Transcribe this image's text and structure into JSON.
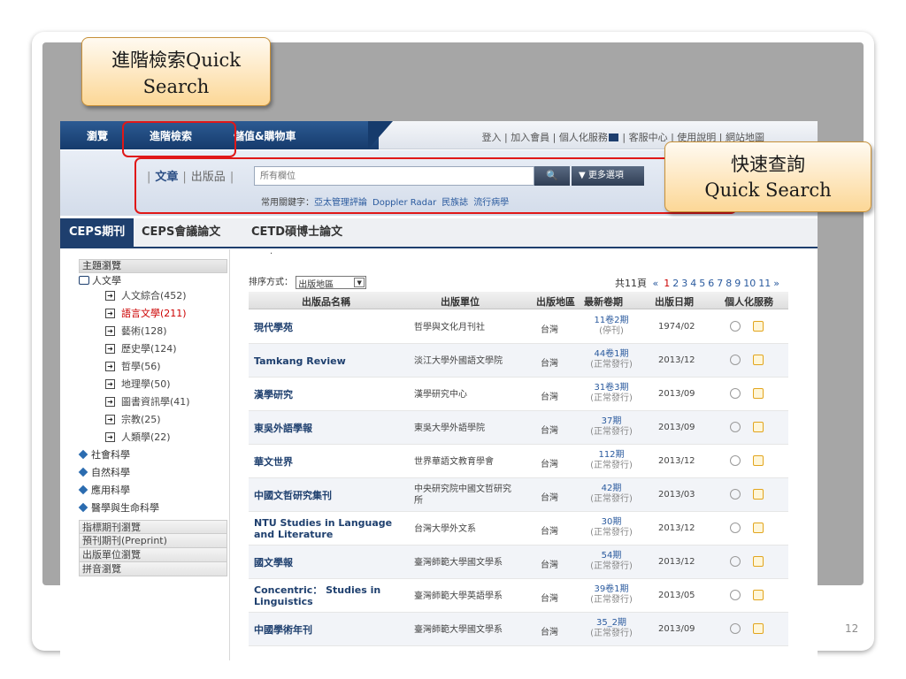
{
  "slide": {
    "page_number": "12"
  },
  "callouts": {
    "advanced_line1": "進階檢索Quick",
    "advanced_line2": "Search",
    "quick_line1": "快速查詢",
    "quick_line2": "Quick Search"
  },
  "topnav": {
    "browse": "瀏覽",
    "advanced": "進階檢索",
    "store": "儲值&購物車",
    "links": {
      "login": "登入",
      "join": "加入會員",
      "personal": "個人化服務",
      "service": "客服中心",
      "help": "使用說明",
      "sitemap": "網站地圖"
    }
  },
  "search": {
    "scope_article": "文章",
    "scope_publication": "出版品",
    "placeholder": "所有欄位",
    "search_icon_glyph": "🔍",
    "more_options": "▼ 更多選項",
    "keywords_label": "常用關鍵字：",
    "keywords": [
      "亞太管理評論",
      "Doppler Radar",
      "民族誌",
      "流行病學"
    ]
  },
  "db_tabs": [
    "CEPS期刊",
    "CEPS會議論文",
    "CETD碩博士論文"
  ],
  "sidebar": {
    "heading": "主題瀏覽",
    "top_category": "人文學",
    "subcategories": [
      {
        "label": "人文綜合(452)",
        "active": false
      },
      {
        "label": "語言文學(211)",
        "active": true
      },
      {
        "label": "藝術(128)",
        "active": false
      },
      {
        "label": "歷史學(124)",
        "active": false
      },
      {
        "label": "哲學(56)",
        "active": false
      },
      {
        "label": "地理學(50)",
        "active": false
      },
      {
        "label": "圖書資訊學(41)",
        "active": false
      },
      {
        "label": "宗教(25)",
        "active": false
      },
      {
        "label": "人類學(22)",
        "active": false
      }
    ],
    "categories": [
      "社會科學",
      "自然科學",
      "應用科學",
      "醫學與生命科學"
    ],
    "links": [
      "指標期刊瀏覽",
      "預刊期刊(Preprint)",
      "出版單位瀏覽",
      "拼音瀏覽"
    ]
  },
  "results": {
    "sort_label": "排序方式：",
    "sort_value": "出版地區",
    "total_pages": "共11頁",
    "prev_glyph": "«",
    "next_glyph": "»",
    "pages": [
      "1",
      "2",
      "3",
      "4",
      "5",
      "6",
      "7",
      "8",
      "9",
      "10",
      "11"
    ],
    "current_page": "1",
    "headers": {
      "name": "出版品名稱",
      "publisher": "出版單位",
      "region": "出版地區",
      "latest": "最新卷期",
      "date": "出版日期",
      "services": "個人化服務"
    },
    "rows": [
      {
        "name": "現代學苑",
        "publisher": "哲學與文化月刊社",
        "region": "台灣",
        "issue": "11卷2期",
        "status": "(停刊)",
        "date": "1974/02"
      },
      {
        "name": "Tamkang Review",
        "publisher": "淡江大學外國語文學院",
        "region": "台灣",
        "issue": "44卷1期",
        "status": "(正常發行)",
        "date": "2013/12"
      },
      {
        "name": "漢學研究",
        "publisher": "漢學研究中心",
        "region": "台灣",
        "issue": "31卷3期",
        "status": "(正常發行)",
        "date": "2013/09"
      },
      {
        "name": "東吳外語學報",
        "publisher": "東吳大學外語學院",
        "region": "台灣",
        "issue": "37期",
        "status": "(正常發行)",
        "date": "2013/09"
      },
      {
        "name": "華文世界",
        "publisher": "世界華語文教育學會",
        "region": "台灣",
        "issue": "112期",
        "status": "(正常發行)",
        "date": "2013/12"
      },
      {
        "name": "中國文哲研究集刊",
        "publisher": "中央研究院中國文哲研究所",
        "region": "台灣",
        "issue": "42期",
        "status": "(正常發行)",
        "date": "2013/03"
      },
      {
        "name": "NTU Studies in Language and Literature",
        "publisher": "台灣大學外文系",
        "region": "台灣",
        "issue": "30期",
        "status": "(正常發行)",
        "date": "2013/12"
      },
      {
        "name": "國文學報",
        "publisher": "臺灣師範大學國文學系",
        "region": "台灣",
        "issue": "54期",
        "status": "(正常發行)",
        "date": "2013/12"
      },
      {
        "name": "Concentric： Studies in Linguistics",
        "publisher": "臺灣師範大學英語學系",
        "region": "台灣",
        "issue": "39卷1期",
        "status": "(正常發行)",
        "date": "2013/05"
      },
      {
        "name": "中國學術年刊",
        "publisher": "臺灣師範大學國文學系",
        "region": "台灣",
        "issue": "35_2期",
        "status": "(正常發行)",
        "date": "2013/09"
      }
    ]
  }
}
